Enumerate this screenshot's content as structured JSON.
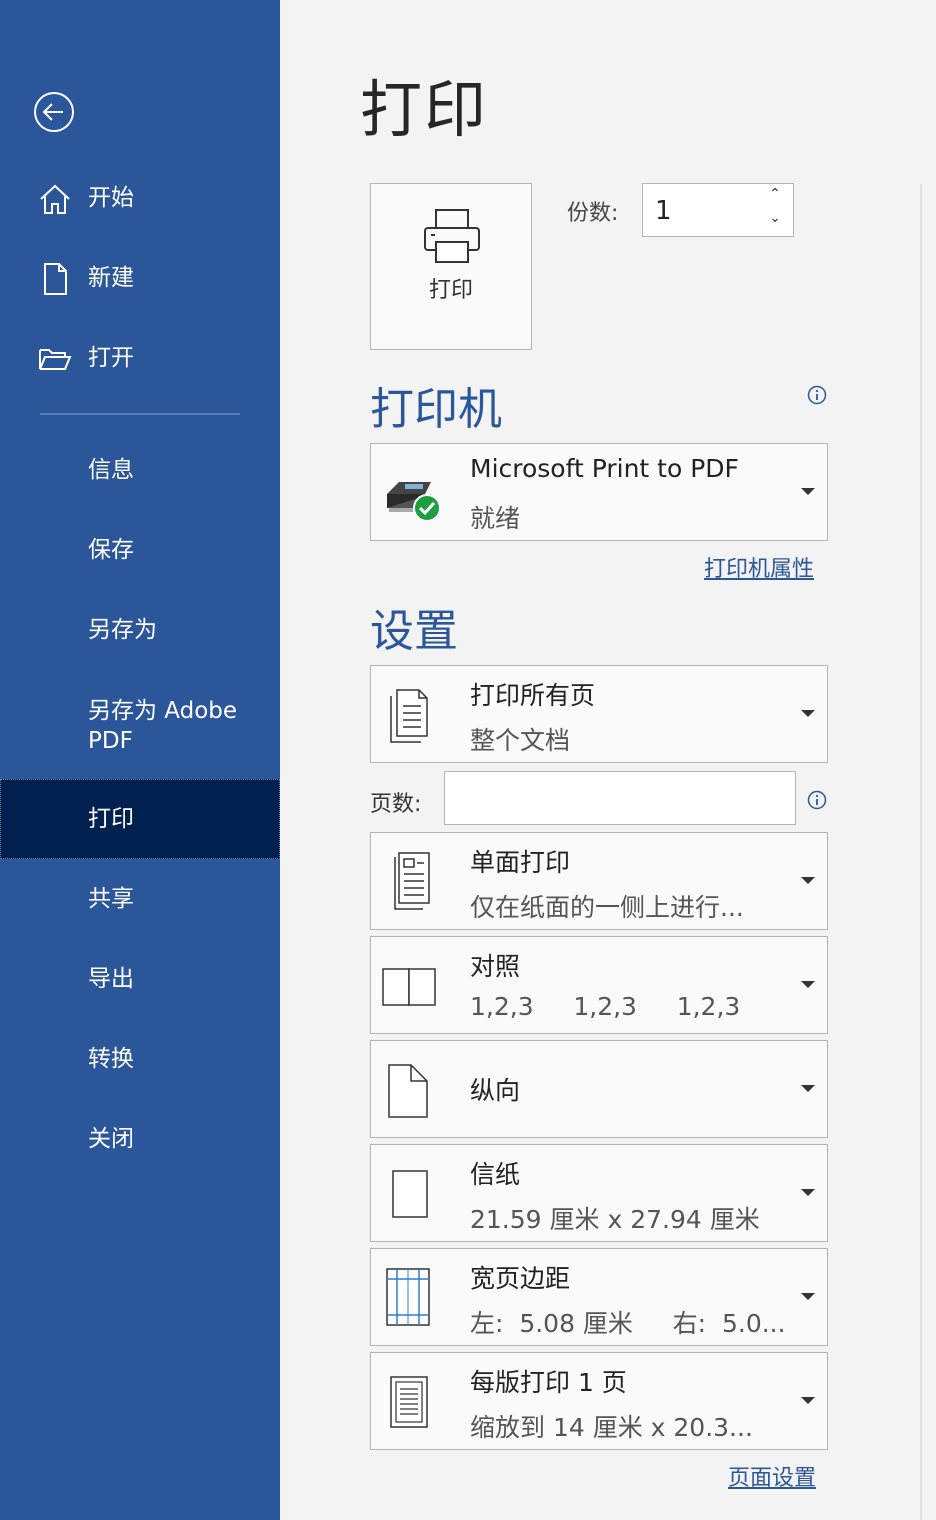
{
  "sidebar": {
    "back_label": "",
    "items": [
      {
        "label": "开始",
        "icon": "home-icon"
      },
      {
        "label": "新建",
        "icon": "new-document-icon"
      },
      {
        "label": "打开",
        "icon": "open-folder-icon"
      },
      {
        "label": "信息"
      },
      {
        "label": "保存"
      },
      {
        "label": "另存为"
      },
      {
        "label": "另存为 Adobe PDF"
      },
      {
        "label": "打印",
        "active": true
      },
      {
        "label": "共享"
      },
      {
        "label": "导出"
      },
      {
        "label": "转换"
      },
      {
        "label": "关闭"
      }
    ],
    "colors": {
      "background": "#2b579a",
      "active": "#002050"
    }
  },
  "main": {
    "title": "打印",
    "print_button_label": "打印",
    "copies_label": "份数:",
    "copies_value": "1",
    "printer_heading": "打印机",
    "printer": {
      "name": "Microsoft Print to PDF",
      "status": "就绪"
    },
    "printer_properties_link": "打印机属性",
    "settings_heading": "设置",
    "pages_label": "页数:",
    "pages_value": "",
    "settings": [
      {
        "title": "打印所有页",
        "subtitle": "整个文档",
        "icon": "all-pages-icon"
      },
      {
        "title": "单面打印",
        "subtitle": "仅在纸面的一侧上进行...",
        "icon": "one-sided-icon"
      },
      {
        "title": "对照",
        "subtitle": "1,2,3     1,2,3     1,2,3",
        "icon": "collate-icon"
      },
      {
        "title": "纵向",
        "subtitle": "",
        "icon": "portrait-icon"
      },
      {
        "title": "信纸",
        "subtitle": "21.59 厘米 x 27.94 厘米",
        "icon": "paper-size-icon"
      },
      {
        "title": "宽页边距",
        "subtitle": "左:  5.08 厘米     右:  5.0...",
        "icon": "margins-icon"
      },
      {
        "title": "每版打印 1 页",
        "subtitle": "缩放到 14 厘米 x 20.3...",
        "icon": "pages-per-sheet-icon"
      }
    ],
    "page_setup_link": "页面设置",
    "accent": "#2b579a"
  }
}
